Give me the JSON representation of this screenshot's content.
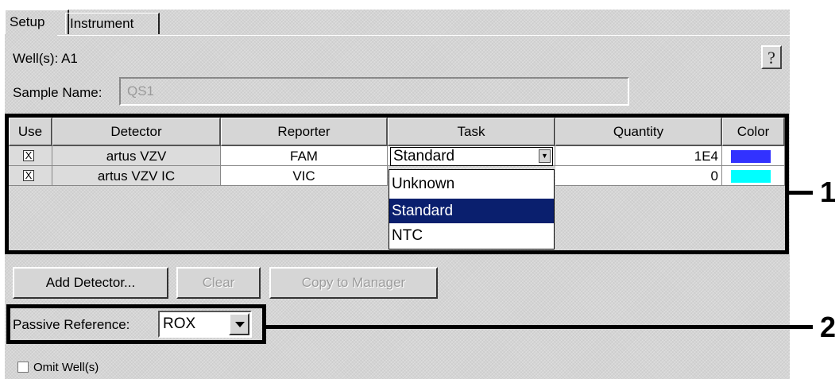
{
  "tabs": [
    {
      "label": "Setup"
    },
    {
      "label": "Instrument"
    }
  ],
  "wells": {
    "label": "Well(s):",
    "value": "A1"
  },
  "help": {
    "label": "?"
  },
  "sample": {
    "label": "Sample Name:",
    "value": "QS1"
  },
  "table": {
    "headers": [
      "Use",
      "Detector",
      "Reporter",
      "Task",
      "Quantity",
      "Color"
    ],
    "rows": [
      {
        "use": "X",
        "detector": "artus VZV",
        "reporter": "FAM",
        "task": "Standard",
        "quantity": "1E4",
        "color": "#3232ff"
      },
      {
        "use": "X",
        "detector": "artus VZV IC",
        "reporter": "VIC",
        "task": "",
        "quantity": "0",
        "color": "#00ffff"
      }
    ]
  },
  "task_dropdown": {
    "selected": "Standard",
    "options": [
      "Unknown",
      "Standard",
      "NTC"
    ],
    "highlighted_index": 1
  },
  "buttons": {
    "add_detector": "Add Detector...",
    "clear": "Clear",
    "copy_to_manager": "Copy to Manager"
  },
  "passive_reference": {
    "label": "Passive Reference:",
    "value": "ROX"
  },
  "omit": {
    "label": "Omit Well(s)"
  },
  "callouts": [
    "1",
    "2"
  ]
}
